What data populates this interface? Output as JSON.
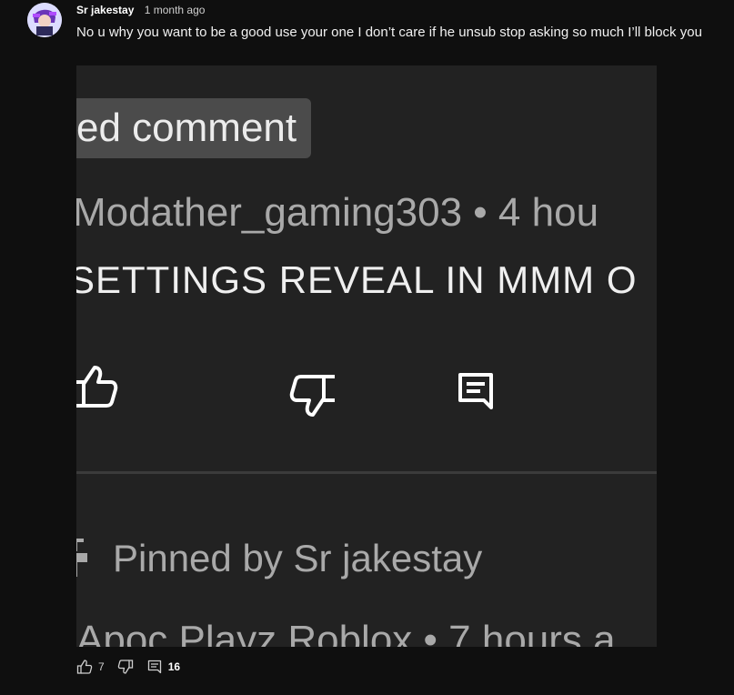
{
  "post": {
    "author": "Sr jakestay",
    "time": "1 month ago",
    "text": "No u why you want to be a good use your one I don’t care if he unsub stop asking so much I’ll block you"
  },
  "screenshot": {
    "badge_text": "ed comment",
    "handle_text": "Modather_gaming303 • 4 hou",
    "caps_text": "SETTINGS REVEAL IN MMM O",
    "pinned_text": "Pinned by Sr jakestay",
    "next_author_text": "Apoc Playz Roblox • 7 hours a"
  },
  "actions": {
    "likes": "7",
    "replies": "16"
  },
  "icons": {
    "avatar": "avatar-image",
    "like": "thumbs-up-icon",
    "dislike": "thumbs-down-icon",
    "comment": "comment-icon",
    "pin": "pin-icon"
  }
}
